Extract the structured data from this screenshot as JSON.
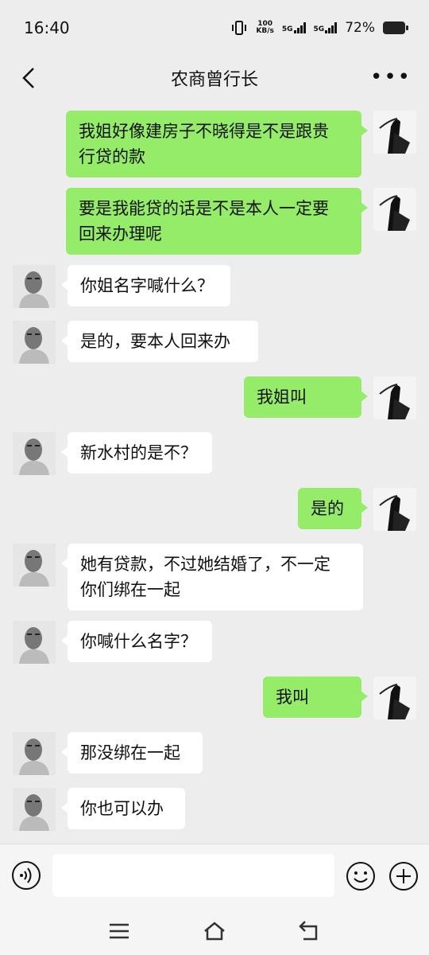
{
  "status_bar": {
    "time": "16:40",
    "net_speed_value": "100",
    "net_speed_unit": "KB/s",
    "sim1": "5G",
    "sim2": "5G",
    "battery": "72%"
  },
  "header": {
    "title": "农商曾行长"
  },
  "messages": [
    {
      "direction": "out",
      "text_lines": [
        "我姐好像建房子不晓得是不是跟贵",
        "行贷的款"
      ]
    },
    {
      "direction": "out",
      "text_lines": [
        "要是我能贷的话是不是本人一定要",
        "回来办理呢"
      ]
    },
    {
      "direction": "in",
      "text_lines": [
        "你姐名字喊什么？"
      ]
    },
    {
      "direction": "in",
      "text_lines": [
        "是的，要本人回来办"
      ]
    },
    {
      "direction": "out",
      "text_lines": [
        "我姐叫"
      ]
    },
    {
      "direction": "in",
      "text_lines": [
        "新水村的是不？"
      ]
    },
    {
      "direction": "out",
      "text_lines": [
        "是的"
      ]
    },
    {
      "direction": "in",
      "text_lines": [
        "她有贷款，不过她结婚了，不一定",
        "你们绑在一起"
      ]
    },
    {
      "direction": "in",
      "text_lines": [
        "你喊什么名字？"
      ]
    },
    {
      "direction": "out",
      "text_lines": [
        "我叫"
      ]
    },
    {
      "direction": "in",
      "text_lines": [
        "那没绑在一起"
      ]
    },
    {
      "direction": "in",
      "text_lines": [
        "你也可以办"
      ]
    }
  ],
  "input_bar": {
    "placeholder": "",
    "icons": [
      "voice-icon",
      "emoji-icon",
      "plus-icon"
    ]
  },
  "system_nav": {
    "icons": [
      "menu-icon",
      "home-icon",
      "back-nav-icon"
    ]
  },
  "colors": {
    "outgoing_bubble": "#95ec69",
    "incoming_bubble": "#ffffff",
    "background": "#ededed"
  }
}
